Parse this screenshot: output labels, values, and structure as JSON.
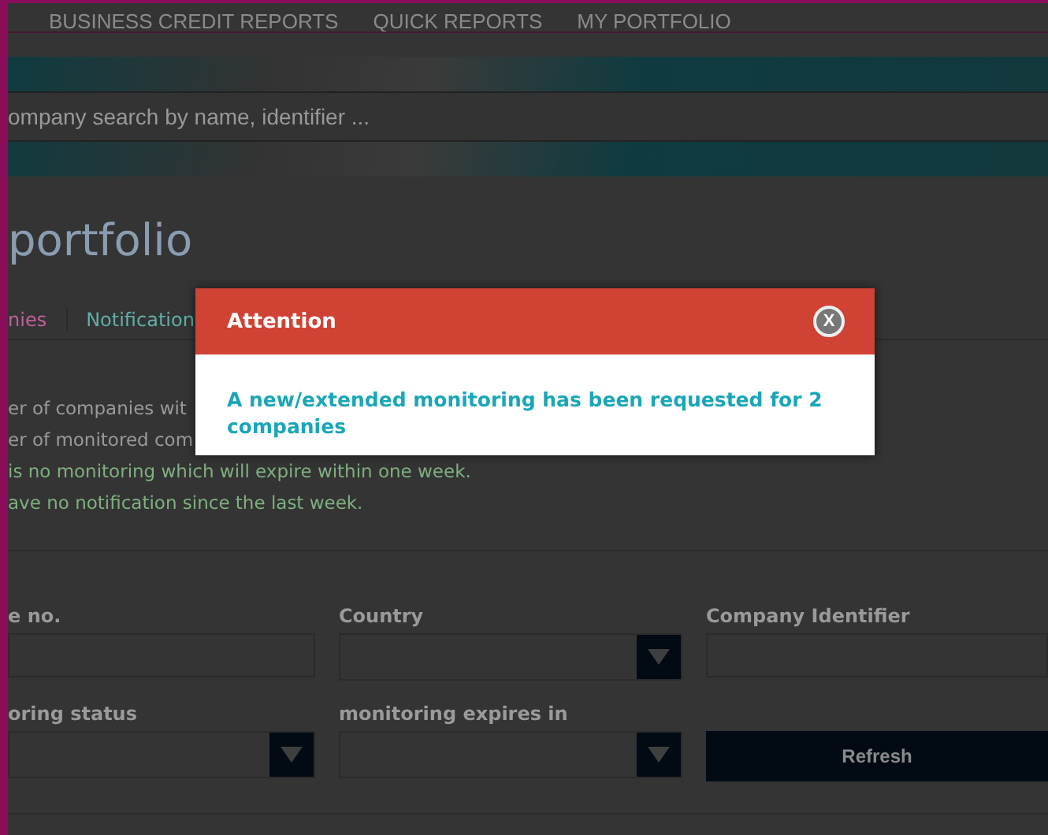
{
  "nav": {
    "items": [
      "BUSINESS CREDIT REPORTS",
      "QUICK REPORTS",
      "MY PORTFOLIO"
    ]
  },
  "search": {
    "placeholder": "ompany search by name, identifier ..."
  },
  "page_title": "portfolio",
  "tabs": [
    {
      "label": "nies",
      "selected": true
    },
    {
      "label": "Notification",
      "selected": false
    }
  ],
  "summary": [
    {
      "text": "er of companies wit",
      "kind": "plain"
    },
    {
      "text": "er of monitored com",
      "kind": "plain"
    },
    {
      "text": "is no monitoring which will expire within one week.",
      "kind": "notice"
    },
    {
      "text": "ave no notification since the last week.",
      "kind": "notice"
    }
  ],
  "filters": [
    {
      "label": "e no.",
      "kind": "input"
    },
    {
      "label": "Country",
      "kind": "select"
    },
    {
      "label": "Company Identifier",
      "kind": "input"
    },
    {
      "label": "oring status",
      "kind": "select"
    },
    {
      "label": "monitoring expires in",
      "kind": "select"
    },
    {
      "label": "Refresh",
      "kind": "button"
    }
  ],
  "dialog": {
    "title": "Attention",
    "close": "X",
    "message": "A new/extended monitoring has been requested for 2 companies"
  }
}
